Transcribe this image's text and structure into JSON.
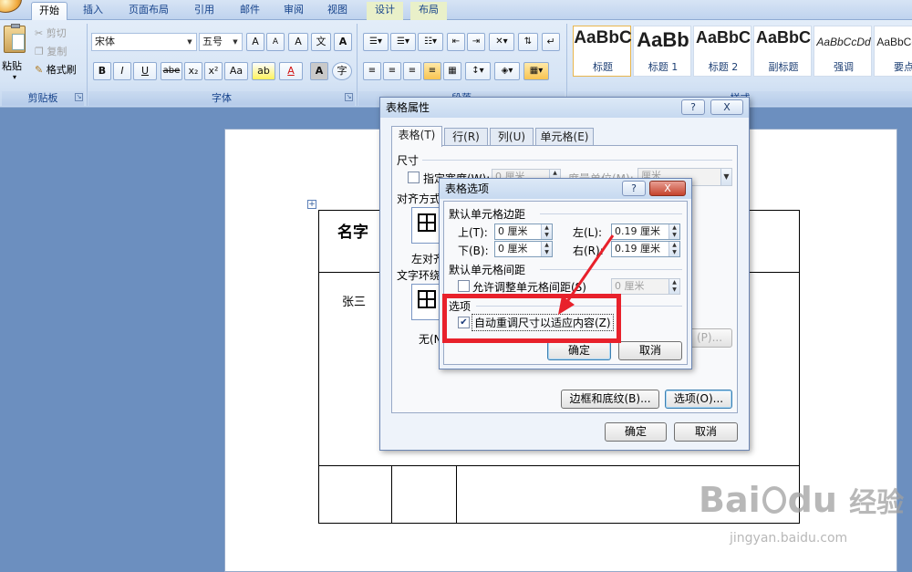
{
  "ribbon_tabs": [
    "开始",
    "插入",
    "页面布局",
    "引用",
    "邮件",
    "审阅",
    "视图",
    "设计",
    "布局"
  ],
  "clipboard": {
    "paste": "粘贴",
    "cut": "剪切",
    "copy": "复制",
    "format_painter": "格式刷",
    "group_label": "剪贴板"
  },
  "font": {
    "name": "宋体",
    "size": "五号",
    "grow": "A",
    "shrink": "A",
    "clear": "A",
    "phonetic": "文",
    "border_char": "A",
    "bold": "B",
    "italic": "I",
    "underline": "U",
    "strike": "abe",
    "subscript": "x₂",
    "superscript": "x²",
    "case": "Aa",
    "highlight": "ab",
    "color": "A",
    "shade": "A",
    "enclose": "字",
    "group_label": "字体"
  },
  "paragraph": {
    "group_label": "段落"
  },
  "styles": {
    "group_label": "样式",
    "items": [
      {
        "sample": "AaBbC",
        "name": "标题"
      },
      {
        "sample": "AaBb",
        "name": "标题 1"
      },
      {
        "sample": "AaBbC",
        "name": "标题 2"
      },
      {
        "sample": "AaBbC",
        "name": "副标题"
      },
      {
        "sample": "AaBbCcDd",
        "name": "强调"
      },
      {
        "sample": "AaBbCcDd",
        "name": "要点"
      }
    ]
  },
  "document": {
    "cell_header": "名字",
    "cell_name": "张三",
    "move_handle": "+"
  },
  "table_properties": {
    "title": "表格属性",
    "help": "?",
    "close": "X",
    "tabs": [
      "表格(T)",
      "行(R)",
      "列(U)",
      "单元格(E)"
    ],
    "size_label": "尺寸",
    "preferred_width": "指定宽度(W):",
    "width_value": "0 厘米",
    "measure_in": "度量单位(M):",
    "measure_value": "厘米",
    "alignment_label": "对齐方式",
    "align_left": "左对齐",
    "wrap_label": "文字环绕",
    "wrap_none": "无(N)",
    "positioning": "(P)...",
    "borders_button": "边框和底纹(B)...",
    "options_button": "选项(O)...",
    "ok": "确定",
    "cancel": "取消"
  },
  "table_options": {
    "title": "表格选项",
    "help": "?",
    "close": "X",
    "margins_label": "默认单元格边距",
    "top_label": "上(T):",
    "top_value": "0 厘米",
    "left_label": "左(L):",
    "left_value": "0.19 厘米",
    "bottom_label": "下(B):",
    "bottom_value": "0 厘米",
    "right_label": "右(R):",
    "right_value": "0.19 厘米",
    "spacing_label": "默认单元格间距",
    "allow_spacing": "允许调整单元格间距(S)",
    "spacing_value": "0 厘米",
    "options_label": "选项",
    "autoresize": "自动重调尺寸以适应内容(Z)",
    "autoresize_checked": true,
    "ok": "确定",
    "cancel": "取消"
  },
  "watermark": {
    "brand": "Bai",
    "brand2": "du",
    "cn": "经验",
    "url": "jingyan.baidu.com"
  },
  "colors": {
    "annotation_red": "#e8212b",
    "ribbon_text": "#15428b"
  }
}
